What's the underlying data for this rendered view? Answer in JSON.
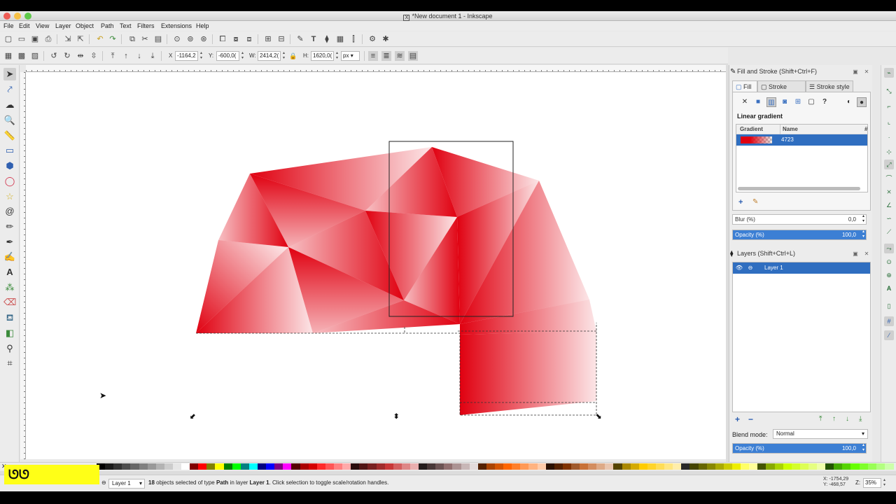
{
  "window": {
    "title": "*New document 1 - Inkscape",
    "traffic_lights": [
      "close",
      "minimize",
      "zoom"
    ]
  },
  "menu": [
    "File",
    "Edit",
    "View",
    "Layer",
    "Object",
    "Path",
    "Text",
    "Filters",
    "Extensions",
    "Help"
  ],
  "toolbar_top": {
    "icons": [
      "new-icon",
      "open-icon",
      "save-icon",
      "print-icon",
      "import-icon",
      "export-icon",
      "undo-icon",
      "redo-icon",
      "copy-icon",
      "cut-icon",
      "paste-icon",
      "zoom-selection-icon",
      "zoom-drawing-icon",
      "zoom-page-icon",
      "duplicate-icon",
      "clone-icon",
      "unlink-clone-icon",
      "group-icon",
      "ungroup-icon",
      "xml-editor-icon",
      "text-font-icon",
      "layers-icon",
      "fill-stroke-icon",
      "align-icon",
      "preferences-icon",
      "document-properties-icon"
    ]
  },
  "toolbar_select": {
    "x_label": "X",
    "x_value": "-1164,2",
    "y_label": "Y:",
    "y_value": "-600,0(",
    "w_label": "W:",
    "w_value": "2414,2(",
    "h_label": "H:",
    "h_value": "1620,0(",
    "unit": "px"
  },
  "tools": [
    "selector-icon",
    "node-icon",
    "tweak-icon",
    "zoom-icon",
    "measure-icon",
    "rectangle-icon",
    "3d-box-icon",
    "ellipse-icon",
    "star-icon",
    "spiral-icon",
    "pencil-icon",
    "pen-icon",
    "calligraphy-icon",
    "text-icon",
    "spray-icon",
    "eraser-icon",
    "bucket-icon",
    "gradient-icon",
    "dropper-icon",
    "connector-icon"
  ],
  "fill_stroke": {
    "title": "Fill and Stroke (Shift+Ctrl+F)",
    "tabs": [
      "Fill",
      "Stroke paint",
      "Stroke style"
    ],
    "active_tab": "Fill",
    "paint_types": [
      "no-paint-icon",
      "flat-color-icon",
      "linear-gradient-icon",
      "radial-gradient-icon",
      "mesh-icon",
      "pattern-icon",
      "unset-paint-icon",
      "fill-rule-evenodd-icon",
      "fill-rule-nonzero-icon"
    ],
    "mode_label": "Linear gradient",
    "table_headers": [
      "Gradient",
      "Name",
      "#"
    ],
    "gradient_rows": [
      {
        "name": "4723",
        "color": "#e00010"
      }
    ],
    "blur_label": "Blur (%)",
    "blur_value": "0,0",
    "opacity_label": "Opacity (%)",
    "opacity_value": "100,0"
  },
  "layers": {
    "title": "Layers (Shift+Ctrl+L)",
    "rows": [
      {
        "name": "Layer 1",
        "visible": true,
        "locked": false
      }
    ],
    "blend_label": "Blend mode:",
    "blend_value": "Normal",
    "opacity_label": "Opacity (%)",
    "opacity_value": "100,0"
  },
  "status": {
    "layer_value": "Layer 1",
    "message_count": "18",
    "message_a": " objects selected of type ",
    "message_b": "Path",
    "message_c": " in layer ",
    "message_d": "Layer 1",
    "message_e": ". Click selection to toggle scale/rotation handles.",
    "cursor_x": "X: -1754,29",
    "cursor_y": "Y: -468,57",
    "zoom_label": "Z:",
    "zoom_value": "35%",
    "overlay_text": "ᘎᘎ"
  },
  "colors": {
    "accent": "#2f6ec0",
    "shape_red": "#e00010",
    "yellow_overlay": "#ffff17"
  },
  "palette": [
    "#000000",
    "#1a1a1a",
    "#333333",
    "#4d4d4d",
    "#666666",
    "#808080",
    "#999999",
    "#b3b3b3",
    "#cccccc",
    "#e6e6e6",
    "#ffffff",
    "#800000",
    "#ff0000",
    "#808000",
    "#ffff00",
    "#008000",
    "#00ff00",
    "#008080",
    "#00ffff",
    "#000080",
    "#0000ff",
    "#800080",
    "#ff00ff",
    "#550000",
    "#aa0000",
    "#d40000",
    "#ff2a2a",
    "#ff5555",
    "#ff8080",
    "#ffaaaa",
    "#280b0b",
    "#501616",
    "#782121",
    "#a02c2c",
    "#c83737",
    "#d35f5f",
    "#de8787",
    "#e9afaf",
    "#241c1c",
    "#483737",
    "#6c5353",
    "#916f6f",
    "#ac9393",
    "#c8b7b7",
    "#e3dbdb",
    "#552200",
    "#aa4400",
    "#d45500",
    "#ff6600",
    "#ff7f2a",
    "#ff9955",
    "#ffb380",
    "#ffccaa",
    "#2b1100",
    "#552200",
    "#803300",
    "#a05a2c",
    "#c87137",
    "#d38d5f",
    "#deaa87",
    "#e9c6af",
    "#554400",
    "#aa8800",
    "#d4aa00",
    "#ffcc00",
    "#ffd42a",
    "#ffdd55",
    "#ffe680",
    "#ffeeaa",
    "#282828",
    "#444400",
    "#666600",
    "#888800",
    "#aaaa00",
    "#cccc00",
    "#eeee00",
    "#ffff66",
    "#ffff99",
    "#445500",
    "#88aa00",
    "#aad400",
    "#ccff00",
    "#d4ff2a",
    "#ddff55",
    "#e5ff80",
    "#eeffaa",
    "#225500",
    "#44aa00",
    "#55d400",
    "#66ff00",
    "#7fff2a",
    "#99ff55",
    "#b3ff80",
    "#ccffaa"
  ]
}
